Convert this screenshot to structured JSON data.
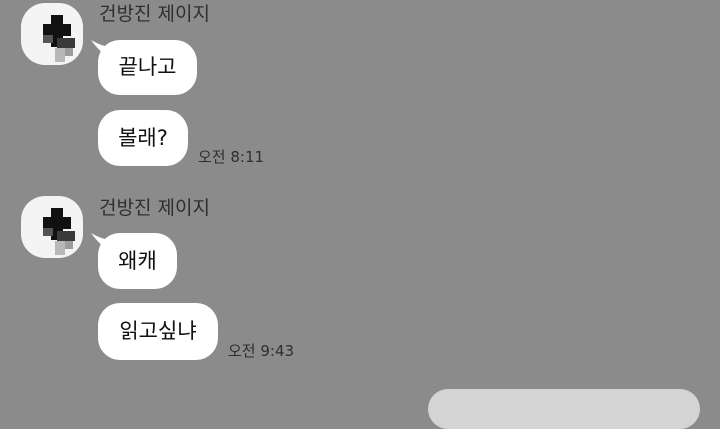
{
  "groups": [
    {
      "sender": "건방진 제이지",
      "messages": [
        {
          "text": "끝나고"
        },
        {
          "text": "볼래?"
        }
      ],
      "time": "오전 8:11"
    },
    {
      "sender": "건방진 제이지",
      "messages": [
        {
          "text": "왜캐"
        },
        {
          "text": "읽고싶냐"
        }
      ],
      "time": "오전 9:43"
    }
  ],
  "colors": {
    "background": "#8b8b8b",
    "bubble": "#ffffff",
    "my_bubble": "#d4d4d4"
  }
}
